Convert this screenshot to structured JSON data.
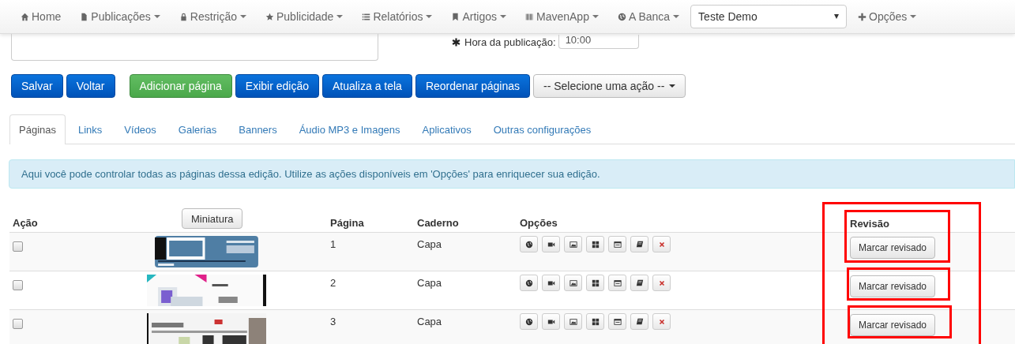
{
  "navbar": {
    "items": [
      {
        "label": "Home",
        "dropdown": false
      },
      {
        "label": "Publicações",
        "dropdown": true
      },
      {
        "label": "Restrição",
        "dropdown": true
      },
      {
        "label": "Publicidade",
        "dropdown": true
      },
      {
        "label": "Relatórios",
        "dropdown": true
      },
      {
        "label": "Artigos",
        "dropdown": true
      },
      {
        "label": "MavenApp",
        "dropdown": true
      },
      {
        "label": "A Banca",
        "dropdown": true
      }
    ],
    "select": {
      "value": "Teste Demo"
    },
    "options": {
      "label": "Opções",
      "dropdown": true
    }
  },
  "form": {
    "time_label": "Hora da publicação:",
    "time_value": "10:00"
  },
  "actions": [
    {
      "label": "Salvar",
      "kind": "primary"
    },
    {
      "label": "Voltar",
      "kind": "primary"
    },
    {
      "label": "Adicionar página",
      "kind": "success"
    },
    {
      "label": "Exibir edição",
      "kind": "primary"
    },
    {
      "label": "Atualiza a tela",
      "kind": "primary"
    },
    {
      "label": "Reordenar páginas",
      "kind": "primary"
    },
    {
      "label": "-- Selecione uma ação --",
      "kind": "dropdown"
    }
  ],
  "tabs": [
    {
      "label": "Páginas",
      "selected": true
    },
    {
      "label": "Links",
      "selected": false
    },
    {
      "label": "Vídeos",
      "selected": false
    },
    {
      "label": "Galerias",
      "selected": false
    },
    {
      "label": "Banners",
      "selected": false
    },
    {
      "label": "Áudio MP3 e Imagens",
      "selected": false
    },
    {
      "label": "Aplicativos",
      "selected": false
    },
    {
      "label": "Outras configurações",
      "selected": false
    }
  ],
  "info": "Aqui você pode controlar todas as páginas dessa edição. Utilize as ações disponíveis em 'Opções' para enriquecer sua edição.",
  "table": {
    "columns": [
      "Ação",
      "Miniatura",
      "Página",
      "Caderno",
      "Opções",
      "Revisão"
    ],
    "rows": [
      {
        "checked": false,
        "page": "1",
        "section": "Capa",
        "review": "Marcar revisado"
      },
      {
        "checked": false,
        "page": "2",
        "section": "Capa",
        "review": "Marcar revisado"
      },
      {
        "checked": false,
        "page": "3",
        "section": "Capa",
        "review": "Marcar revisado"
      }
    ]
  }
}
